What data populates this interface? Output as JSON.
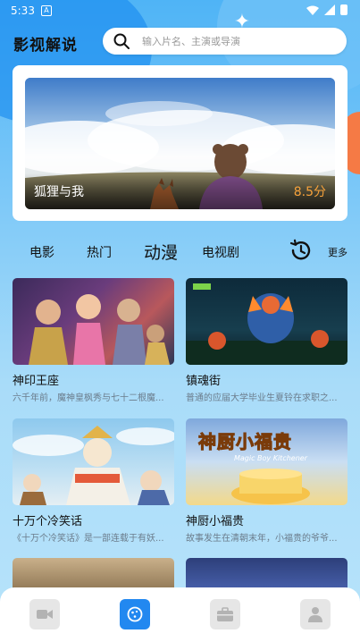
{
  "status": {
    "time": "5:33",
    "notification": "A"
  },
  "app": {
    "title": "影视解说"
  },
  "search": {
    "placeholder": "输入片名、主演或导演"
  },
  "banner": {
    "title": "狐狸与我",
    "score": "8.5分"
  },
  "tabs": [
    {
      "label": "电影",
      "active": false
    },
    {
      "label": "热门",
      "active": false
    },
    {
      "label": "动漫",
      "active": true
    },
    {
      "label": "电视剧",
      "active": false
    }
  ],
  "more_label": "更多",
  "cards": [
    {
      "name": "神印王座",
      "desc": "六千年前，魔神皇枫秀与七十二根魔..."
    },
    {
      "name": "镇魂街",
      "desc": "普通的应届大学毕业生夏铃在求职之..."
    },
    {
      "name": "十万个冷笑话",
      "desc": "《十万个冷笑话》是一部连载于有妖..."
    },
    {
      "name": "神厨小福贵",
      "desc": "故事发生在清朝末年，小福贵的爷爷..."
    }
  ],
  "poster_text": {
    "title": "神厨小福贵",
    "subtitle": "Magic Boy Kitchener"
  },
  "bottom_nav": [
    {
      "icon": "video-camera-icon",
      "active": false
    },
    {
      "icon": "cookie-icon",
      "active": true
    },
    {
      "icon": "briefcase-icon",
      "active": false
    },
    {
      "icon": "user-icon",
      "active": false
    }
  ],
  "colors": {
    "accent": "#2288f0",
    "score": "#f7a23b"
  }
}
